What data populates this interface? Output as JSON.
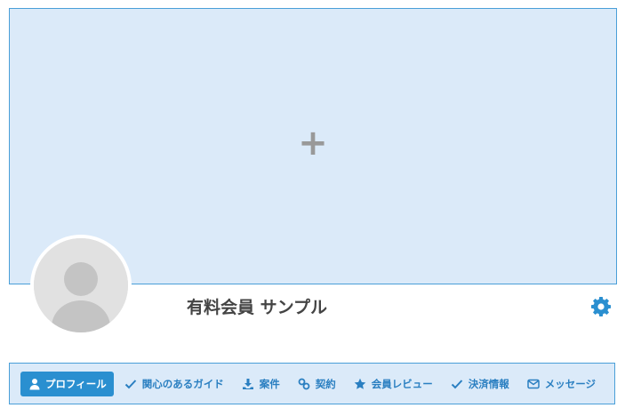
{
  "cover": {
    "add_symbol": "+"
  },
  "profile": {
    "name": "有料会員 サンプル"
  },
  "tabs": [
    {
      "label": "プロフィール",
      "icon": "user-icon",
      "active": true
    },
    {
      "label": "関心のあるガイド",
      "icon": "check-icon",
      "active": false
    },
    {
      "label": "案件",
      "icon": "download-icon",
      "active": false
    },
    {
      "label": "契約",
      "icon": "link-icon",
      "active": false
    },
    {
      "label": "会員レビュー",
      "icon": "star-icon",
      "active": false
    },
    {
      "label": "決済情報",
      "icon": "check-icon",
      "active": false
    },
    {
      "label": "メッセージ",
      "icon": "envelope-icon",
      "active": false
    }
  ],
  "colors": {
    "accent": "#2a8fd0",
    "tab_text": "#2a7fc1",
    "cover_bg": "#dbeaf9",
    "border": "#4a9fd8"
  }
}
